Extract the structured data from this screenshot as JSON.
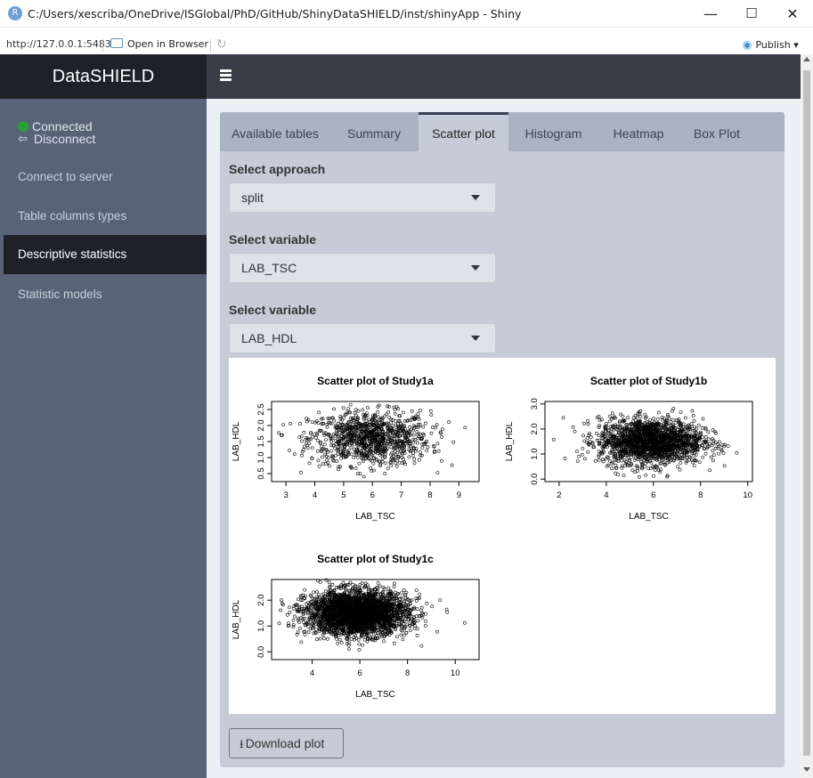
{
  "window": {
    "title": "C:/Users/xescriba/OneDrive/ISGlobal/PhD/GitHub/ShinyDataSHIELD/inst/shinyApp - Shiny",
    "app_icon_letter": "R",
    "url": "http://127.0.0.1:5483",
    "open_in_browser": "Open in Browser",
    "publish": "Publish",
    "minimize_glyph": "—",
    "maximize_glyph": "☐",
    "close_glyph": "✕"
  },
  "header": {
    "brand": "DataSHIELD"
  },
  "sidebar": {
    "status_connected": "Connected",
    "disconnect": "Disconnect",
    "items": [
      {
        "label": "Connect to server"
      },
      {
        "label": "Table columns types"
      },
      {
        "label": "Descriptive statistics",
        "active": true
      },
      {
        "label": "Statistic models"
      }
    ]
  },
  "tabs": [
    {
      "label": "Available tables"
    },
    {
      "label": "Summary"
    },
    {
      "label": "Scatter plot",
      "active": true
    },
    {
      "label": "Histogram"
    },
    {
      "label": "Heatmap"
    },
    {
      "label": "Box Plot"
    }
  ],
  "form": {
    "approach_label": "Select approach",
    "approach_value": "split",
    "variable1_label": "Select variable",
    "variable1_value": "LAB_TSC",
    "variable2_label": "Select variable",
    "variable2_value": "LAB_HDL"
  },
  "download_label": "Download plot",
  "colors": {
    "accent": "#374152",
    "connected": "#2a9d3a",
    "sidebar": "#596378",
    "header": "#1e2228"
  },
  "chart_data": [
    {
      "type": "scatter",
      "title": "Scatter plot of Study1a",
      "xlabel": "LAB_TSC",
      "ylabel": "LAB_HDL",
      "xlim": [
        2.5,
        9.7
      ],
      "ylim": [
        0.25,
        2.75
      ],
      "xticks": [
        3,
        4,
        5,
        6,
        7,
        8,
        9
      ],
      "yticks": [
        0.5,
        1.0,
        1.5,
        2.0,
        2.5
      ],
      "ytick_labels": [
        "0.5",
        "1.0",
        "1.5",
        "2.0",
        "2.5"
      ],
      "n_points": 1000,
      "x_mean": 5.9,
      "x_sd": 1.05,
      "y_mean": 1.6,
      "y_sd": 0.42
    },
    {
      "type": "scatter",
      "title": "Scatter plot of Study1b",
      "xlabel": "LAB_TSC",
      "ylabel": "LAB_HDL",
      "xlim": [
        1.4,
        10.2
      ],
      "ylim": [
        -0.1,
        3.1
      ],
      "xticks": [
        2,
        4,
        6,
        8,
        10
      ],
      "yticks": [
        0.0,
        1.0,
        2.0,
        3.0
      ],
      "ytick_labels": [
        "0.0",
        "1.0",
        "2.0",
        "3.0"
      ],
      "n_points": 1800,
      "x_mean": 5.9,
      "x_sd": 1.1,
      "y_mean": 1.5,
      "y_sd": 0.45
    },
    {
      "type": "scatter",
      "title": "Scatter plot of Study1c",
      "xlabel": "LAB_TSC",
      "ylabel": "LAB_HDL",
      "xlim": [
        2.3,
        11.0
      ],
      "ylim": [
        -0.3,
        2.8
      ],
      "xticks": [
        4,
        6,
        8,
        10
      ],
      "yticks": [
        0.0,
        1.0,
        2.0
      ],
      "ytick_labels": [
        "0.0",
        "1.0",
        "2.0"
      ],
      "n_points": 3000,
      "x_mean": 5.9,
      "x_sd": 1.05,
      "y_mean": 1.5,
      "y_sd": 0.42
    }
  ]
}
